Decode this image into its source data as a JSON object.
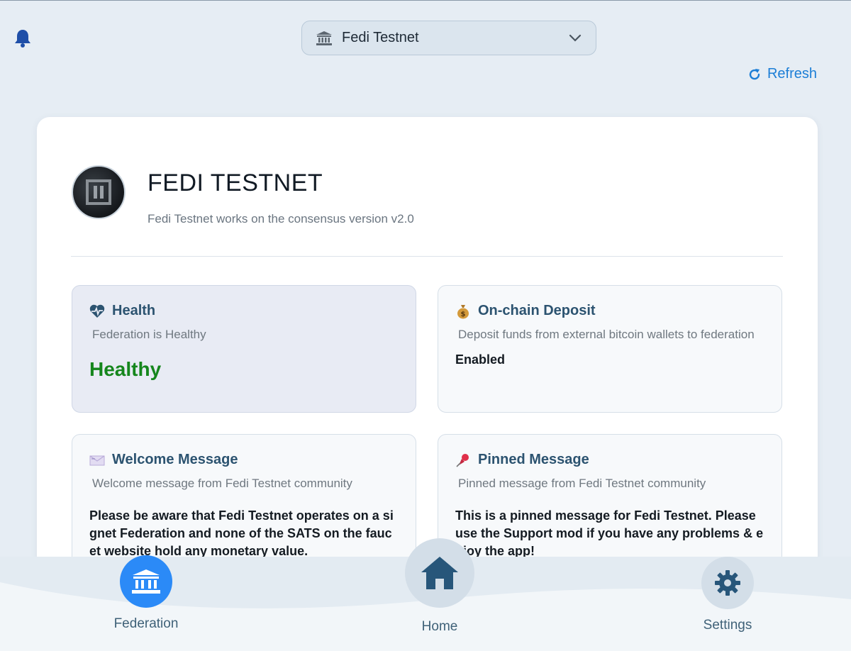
{
  "header": {
    "federation_selector": "Fedi Testnet",
    "refresh_label": "Refresh"
  },
  "federation": {
    "title": "FEDI TESTNET",
    "subtitle": "Fedi Testnet works on the consensus version v2.0"
  },
  "tiles": {
    "health": {
      "icon": "heart-pulse-icon",
      "title": "Health",
      "description": "Federation is Healthy",
      "value": "Healthy",
      "value_color": "#15861c"
    },
    "deposit": {
      "icon": "money-bag-icon",
      "title": "On-chain Deposit",
      "description": "Deposit funds from external bitcoin wallets to federation",
      "value": "Enabled"
    },
    "welcome": {
      "icon": "envelope-icon",
      "title": "Welcome Message",
      "description": "Welcome message from Fedi Testnet community",
      "body": "Please be aware that Fedi Testnet operates on a signet Federation and none of the SATS on the faucet website hold any monetary value."
    },
    "pinned": {
      "icon": "pushpin-icon",
      "title": "Pinned Message",
      "description": "Pinned message from Fedi Testnet community",
      "body": "This is a pinned message for Fedi Testnet. Please use the Support mod if you have any problems & enjoy the app!"
    }
  },
  "nav": {
    "items": [
      {
        "label": "Federation",
        "icon": "bank-icon",
        "active": true
      },
      {
        "label": "Home",
        "icon": "home-icon",
        "active": false
      },
      {
        "label": "Settings",
        "icon": "gear-icon",
        "active": false
      }
    ]
  },
  "colors": {
    "accent": "#1c7ed6",
    "active_nav": "#2b8af7",
    "background": "#e6edf4"
  }
}
